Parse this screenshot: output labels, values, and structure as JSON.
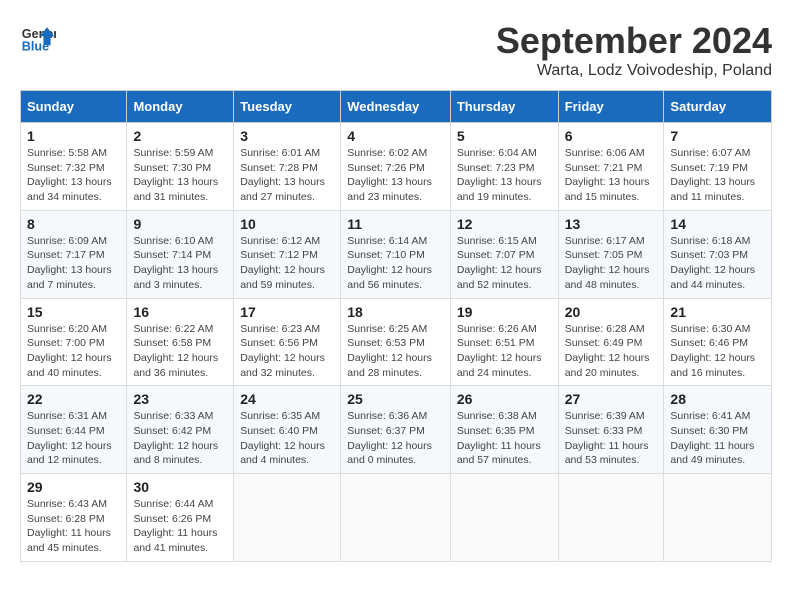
{
  "header": {
    "logo_line1": "General",
    "logo_line2": "Blue",
    "month_title": "September 2024",
    "location": "Warta, Lodz Voivodeship, Poland"
  },
  "weekdays": [
    "Sunday",
    "Monday",
    "Tuesday",
    "Wednesday",
    "Thursday",
    "Friday",
    "Saturday"
  ],
  "weeks": [
    [
      {
        "day": "1",
        "detail": "Sunrise: 5:58 AM\nSunset: 7:32 PM\nDaylight: 13 hours\nand 34 minutes."
      },
      {
        "day": "2",
        "detail": "Sunrise: 5:59 AM\nSunset: 7:30 PM\nDaylight: 13 hours\nand 31 minutes."
      },
      {
        "day": "3",
        "detail": "Sunrise: 6:01 AM\nSunset: 7:28 PM\nDaylight: 13 hours\nand 27 minutes."
      },
      {
        "day": "4",
        "detail": "Sunrise: 6:02 AM\nSunset: 7:26 PM\nDaylight: 13 hours\nand 23 minutes."
      },
      {
        "day": "5",
        "detail": "Sunrise: 6:04 AM\nSunset: 7:23 PM\nDaylight: 13 hours\nand 19 minutes."
      },
      {
        "day": "6",
        "detail": "Sunrise: 6:06 AM\nSunset: 7:21 PM\nDaylight: 13 hours\nand 15 minutes."
      },
      {
        "day": "7",
        "detail": "Sunrise: 6:07 AM\nSunset: 7:19 PM\nDaylight: 13 hours\nand 11 minutes."
      }
    ],
    [
      {
        "day": "8",
        "detail": "Sunrise: 6:09 AM\nSunset: 7:17 PM\nDaylight: 13 hours\nand 7 minutes."
      },
      {
        "day": "9",
        "detail": "Sunrise: 6:10 AM\nSunset: 7:14 PM\nDaylight: 13 hours\nand 3 minutes."
      },
      {
        "day": "10",
        "detail": "Sunrise: 6:12 AM\nSunset: 7:12 PM\nDaylight: 12 hours\nand 59 minutes."
      },
      {
        "day": "11",
        "detail": "Sunrise: 6:14 AM\nSunset: 7:10 PM\nDaylight: 12 hours\nand 56 minutes."
      },
      {
        "day": "12",
        "detail": "Sunrise: 6:15 AM\nSunset: 7:07 PM\nDaylight: 12 hours\nand 52 minutes."
      },
      {
        "day": "13",
        "detail": "Sunrise: 6:17 AM\nSunset: 7:05 PM\nDaylight: 12 hours\nand 48 minutes."
      },
      {
        "day": "14",
        "detail": "Sunrise: 6:18 AM\nSunset: 7:03 PM\nDaylight: 12 hours\nand 44 minutes."
      }
    ],
    [
      {
        "day": "15",
        "detail": "Sunrise: 6:20 AM\nSunset: 7:00 PM\nDaylight: 12 hours\nand 40 minutes."
      },
      {
        "day": "16",
        "detail": "Sunrise: 6:22 AM\nSunset: 6:58 PM\nDaylight: 12 hours\nand 36 minutes."
      },
      {
        "day": "17",
        "detail": "Sunrise: 6:23 AM\nSunset: 6:56 PM\nDaylight: 12 hours\nand 32 minutes."
      },
      {
        "day": "18",
        "detail": "Sunrise: 6:25 AM\nSunset: 6:53 PM\nDaylight: 12 hours\nand 28 minutes."
      },
      {
        "day": "19",
        "detail": "Sunrise: 6:26 AM\nSunset: 6:51 PM\nDaylight: 12 hours\nand 24 minutes."
      },
      {
        "day": "20",
        "detail": "Sunrise: 6:28 AM\nSunset: 6:49 PM\nDaylight: 12 hours\nand 20 minutes."
      },
      {
        "day": "21",
        "detail": "Sunrise: 6:30 AM\nSunset: 6:46 PM\nDaylight: 12 hours\nand 16 minutes."
      }
    ],
    [
      {
        "day": "22",
        "detail": "Sunrise: 6:31 AM\nSunset: 6:44 PM\nDaylight: 12 hours\nand 12 minutes."
      },
      {
        "day": "23",
        "detail": "Sunrise: 6:33 AM\nSunset: 6:42 PM\nDaylight: 12 hours\nand 8 minutes."
      },
      {
        "day": "24",
        "detail": "Sunrise: 6:35 AM\nSunset: 6:40 PM\nDaylight: 12 hours\nand 4 minutes."
      },
      {
        "day": "25",
        "detail": "Sunrise: 6:36 AM\nSunset: 6:37 PM\nDaylight: 12 hours\nand 0 minutes."
      },
      {
        "day": "26",
        "detail": "Sunrise: 6:38 AM\nSunset: 6:35 PM\nDaylight: 11 hours\nand 57 minutes."
      },
      {
        "day": "27",
        "detail": "Sunrise: 6:39 AM\nSunset: 6:33 PM\nDaylight: 11 hours\nand 53 minutes."
      },
      {
        "day": "28",
        "detail": "Sunrise: 6:41 AM\nSunset: 6:30 PM\nDaylight: 11 hours\nand 49 minutes."
      }
    ],
    [
      {
        "day": "29",
        "detail": "Sunrise: 6:43 AM\nSunset: 6:28 PM\nDaylight: 11 hours\nand 45 minutes."
      },
      {
        "day": "30",
        "detail": "Sunrise: 6:44 AM\nSunset: 6:26 PM\nDaylight: 11 hours\nand 41 minutes."
      },
      {
        "day": "",
        "detail": ""
      },
      {
        "day": "",
        "detail": ""
      },
      {
        "day": "",
        "detail": ""
      },
      {
        "day": "",
        "detail": ""
      },
      {
        "day": "",
        "detail": ""
      }
    ]
  ]
}
